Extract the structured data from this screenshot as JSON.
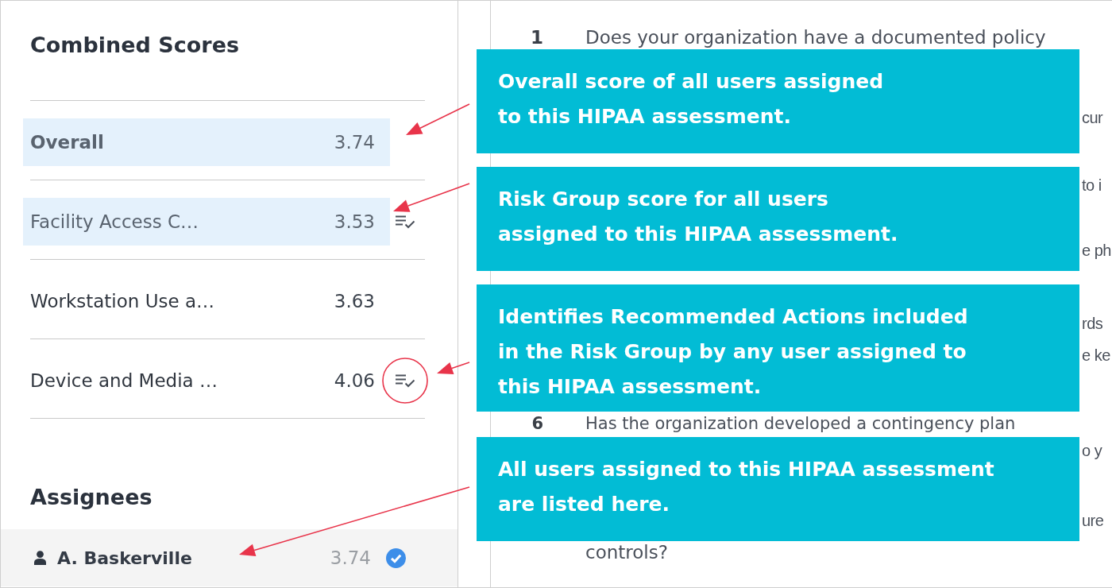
{
  "sidebar": {
    "combined_scores": {
      "title": "Combined Scores",
      "rows": [
        {
          "kind": "total",
          "label": "Overall",
          "score": "3.74",
          "highlighted": true,
          "has_actions": false,
          "circled": false
        },
        {
          "kind": "group",
          "label": "Facility Access C…",
          "score": "3.53",
          "highlighted": true,
          "has_actions": true,
          "circled": false
        },
        {
          "kind": "group",
          "label": "Workstation Use a…",
          "score": "3.63",
          "highlighted": false,
          "has_actions": false,
          "circled": false
        },
        {
          "kind": "group",
          "label": "Device and Media …",
          "score": "4.06",
          "highlighted": false,
          "has_actions": true,
          "circled": true
        }
      ]
    },
    "assignees": {
      "title": "Assignees",
      "items": [
        {
          "name": "A. Baskerville",
          "score": "3.74",
          "verified": true
        }
      ]
    }
  },
  "questions": [
    {
      "number": "1",
      "lines": [
        {
          "kind": "lead",
          "text": "Does your organization have a documented policy"
        }
      ]
    },
    {
      "lines": [
        {
          "kind": "tail",
          "text": "cur"
        }
      ]
    },
    {
      "lines": [
        {
          "kind": "tail",
          "text": "to i"
        }
      ]
    },
    {
      "lines": [
        {
          "kind": "tail",
          "text": "e ph"
        }
      ]
    },
    {
      "lines": [
        {
          "kind": "tail",
          "text": "rds"
        },
        {
          "kind": "tail",
          "text": "e ke"
        }
      ]
    },
    {
      "number": "6",
      "lines": [
        {
          "kind": "lead",
          "text": "Has the organization developed a contingency plan"
        },
        {
          "kind": "tail",
          "text": "o y"
        }
      ]
    },
    {
      "lines": [
        {
          "kind": "tail",
          "text": "ure"
        },
        {
          "kind": "lead",
          "text": "controls?"
        }
      ]
    }
  ],
  "callouts": [
    {
      "lines": [
        "Overall score of all users assigned",
        "to this HIPAA assessment."
      ]
    },
    {
      "lines": [
        "Risk Group score for all users",
        "assigned to this HIPAA assessment."
      ]
    },
    {
      "lines": [
        "Identifies Recommended Actions included",
        "in the Risk Group by any user assigned to",
        "this HIPAA assessment."
      ]
    },
    {
      "lines": [
        "All users assigned to this HIPAA assessment",
        "are listed here."
      ]
    }
  ]
}
